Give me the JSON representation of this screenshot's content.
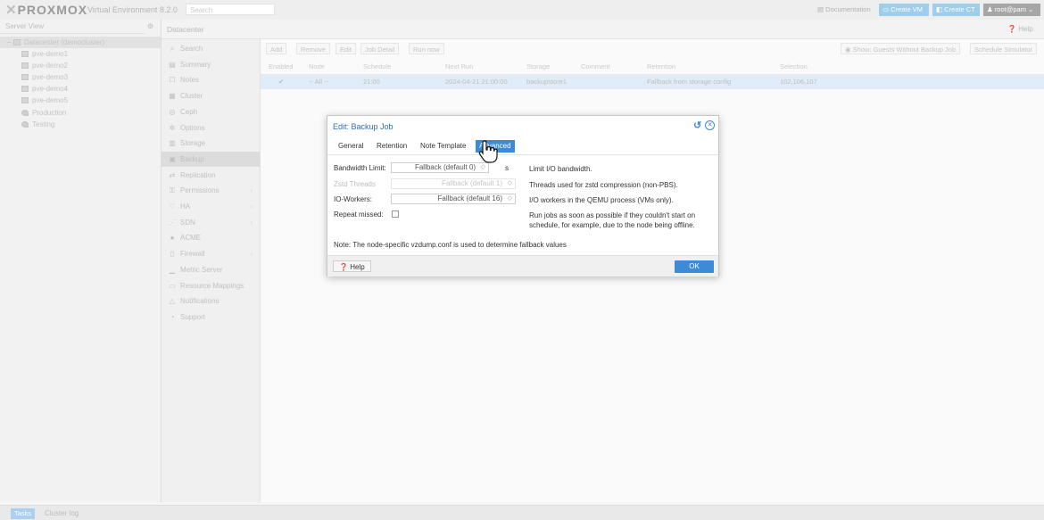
{
  "header": {
    "logo_text": "PROXMOX",
    "product": "Virtual Environment 8.2.0",
    "search_placeholder": "Search",
    "documentation": "Documentation",
    "create_vm": "Create VM",
    "create_ct": "Create CT",
    "user": "root@pam"
  },
  "tree": {
    "view": "Server View",
    "items": [
      {
        "label": "Datacenter (democluster)"
      },
      {
        "label": "pve-demo1"
      },
      {
        "label": "pve-demo2"
      },
      {
        "label": "pve-demo3"
      },
      {
        "label": "pve-demo4"
      },
      {
        "label": "pve-demo5"
      },
      {
        "label": "Production"
      },
      {
        "label": "Testing"
      }
    ]
  },
  "content_header": {
    "title": "Datacenter",
    "help": "Help"
  },
  "menu": {
    "items": [
      {
        "label": "Search",
        "icon": "search-icon",
        "glyph": "⌕"
      },
      {
        "label": "Summary",
        "icon": "book-icon",
        "glyph": "▤"
      },
      {
        "label": "Notes",
        "icon": "notes-icon",
        "glyph": "☐"
      },
      {
        "label": "Cluster",
        "icon": "server-icon",
        "glyph": "▦"
      },
      {
        "label": "Ceph",
        "icon": "ceph-icon",
        "glyph": "◎"
      },
      {
        "label": "Options",
        "icon": "gear-icon",
        "glyph": "✲"
      },
      {
        "label": "Storage",
        "icon": "database-icon",
        "glyph": "▥"
      },
      {
        "label": "Backup",
        "icon": "floppy-icon",
        "glyph": "▣"
      },
      {
        "label": "Replication",
        "icon": "retweet-icon",
        "glyph": "⇄"
      },
      {
        "label": "Permissions",
        "icon": "unlock-icon",
        "glyph": "⚿"
      },
      {
        "label": "HA",
        "icon": "heartbeat-icon",
        "glyph": "♡"
      },
      {
        "label": "SDN",
        "icon": "sdn-icon",
        "glyph": "⋰"
      },
      {
        "label": "ACME",
        "icon": "certificate-icon",
        "glyph": "●"
      },
      {
        "label": "Firewall",
        "icon": "shield-icon",
        "glyph": "▯"
      },
      {
        "label": "Metric Server",
        "icon": "bar-chart-icon",
        "glyph": "▁"
      },
      {
        "label": "Resource Mappings",
        "icon": "folder-icon",
        "glyph": "▭"
      },
      {
        "label": "Notifications",
        "icon": "bell-icon",
        "glyph": "△"
      },
      {
        "label": "Support",
        "icon": "support-icon",
        "glyph": "◔"
      }
    ]
  },
  "toolbar": {
    "add": "Add",
    "remove": "Remove",
    "edit": "Edit",
    "job_detail": "Job Detail",
    "run_now": "Run now",
    "show_guests": "Show: Guests Without Backup Job",
    "schedule_simulator": "Schedule Simulator"
  },
  "grid": {
    "columns": [
      "Enabled",
      "Node",
      "Schedule",
      "Next Run",
      "Storage",
      "Comment",
      "Retention",
      "Selection"
    ],
    "row": {
      "enabled": "✔",
      "node": "-- All --",
      "schedule": "21:00",
      "next_run": "2024-04-21 21:00:00",
      "storage": "backupstore1",
      "comment": "",
      "retention": "Fallback from storage config",
      "selection": "102,106,107"
    }
  },
  "bottom": {
    "tasks": "Tasks",
    "cluster_log": "Cluster log"
  },
  "dialog": {
    "title": "Edit: Backup Job",
    "tabs": [
      "General",
      "Retention",
      "Note Template",
      "Advanced"
    ],
    "active_tab": "Advanced",
    "fields": {
      "bandwidth_label": "Bandwidth Limit:",
      "bandwidth_value": "Fallback (default 0)",
      "bandwidth_unit": "s",
      "bandwidth_desc": "Limit I/O bandwidth.",
      "zstd_label": "Zstd Threads",
      "zstd_value": "Fallback (default 1)",
      "zstd_desc": "Threads used for zstd compression (non-PBS).",
      "io_label": "IO-Workers:",
      "io_value": "Fallback (default 16)",
      "io_desc": "I/O workers in the QEMU process (VMs only).",
      "repeat_label": "Repeat missed:",
      "repeat_checked": false,
      "repeat_desc_1": "Run jobs as soon as possible if they couldn't start on",
      "repeat_desc_2": "schedule, for example, due to the node being offline."
    },
    "note": "Note: The node-specific vzdump.conf is used to determine fallback values",
    "help_button": "Help",
    "ok_button": "OK"
  },
  "colors": {
    "accent": "#3d8bd6",
    "title_blue": "#2f6fb5"
  }
}
